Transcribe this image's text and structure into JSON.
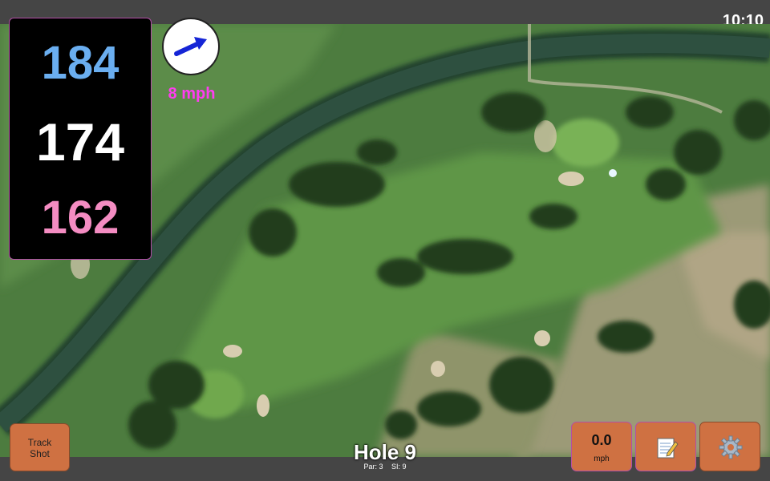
{
  "status": {
    "time": "10:10"
  },
  "yardage": {
    "back": "184",
    "middle": "174",
    "front": "162"
  },
  "wind": {
    "speed_label": "8 mph",
    "icon": "wind-arrow-icon"
  },
  "hole": {
    "title": "Hole 9",
    "par": "Par: 3",
    "si": "SI: 9"
  },
  "buttons": {
    "track_shot_line1": "Track",
    "track_shot_line2": "Shot",
    "wind_value": "0.0",
    "wind_unit": "mph",
    "notes_icon": "notepad-icon",
    "settings_icon": "gear-icon"
  },
  "colors": {
    "back": "#6aaef0",
    "middle": "#ffffff",
    "front": "#f48cc2",
    "wind_text": "#ff3df0",
    "button": "#cf7142"
  }
}
